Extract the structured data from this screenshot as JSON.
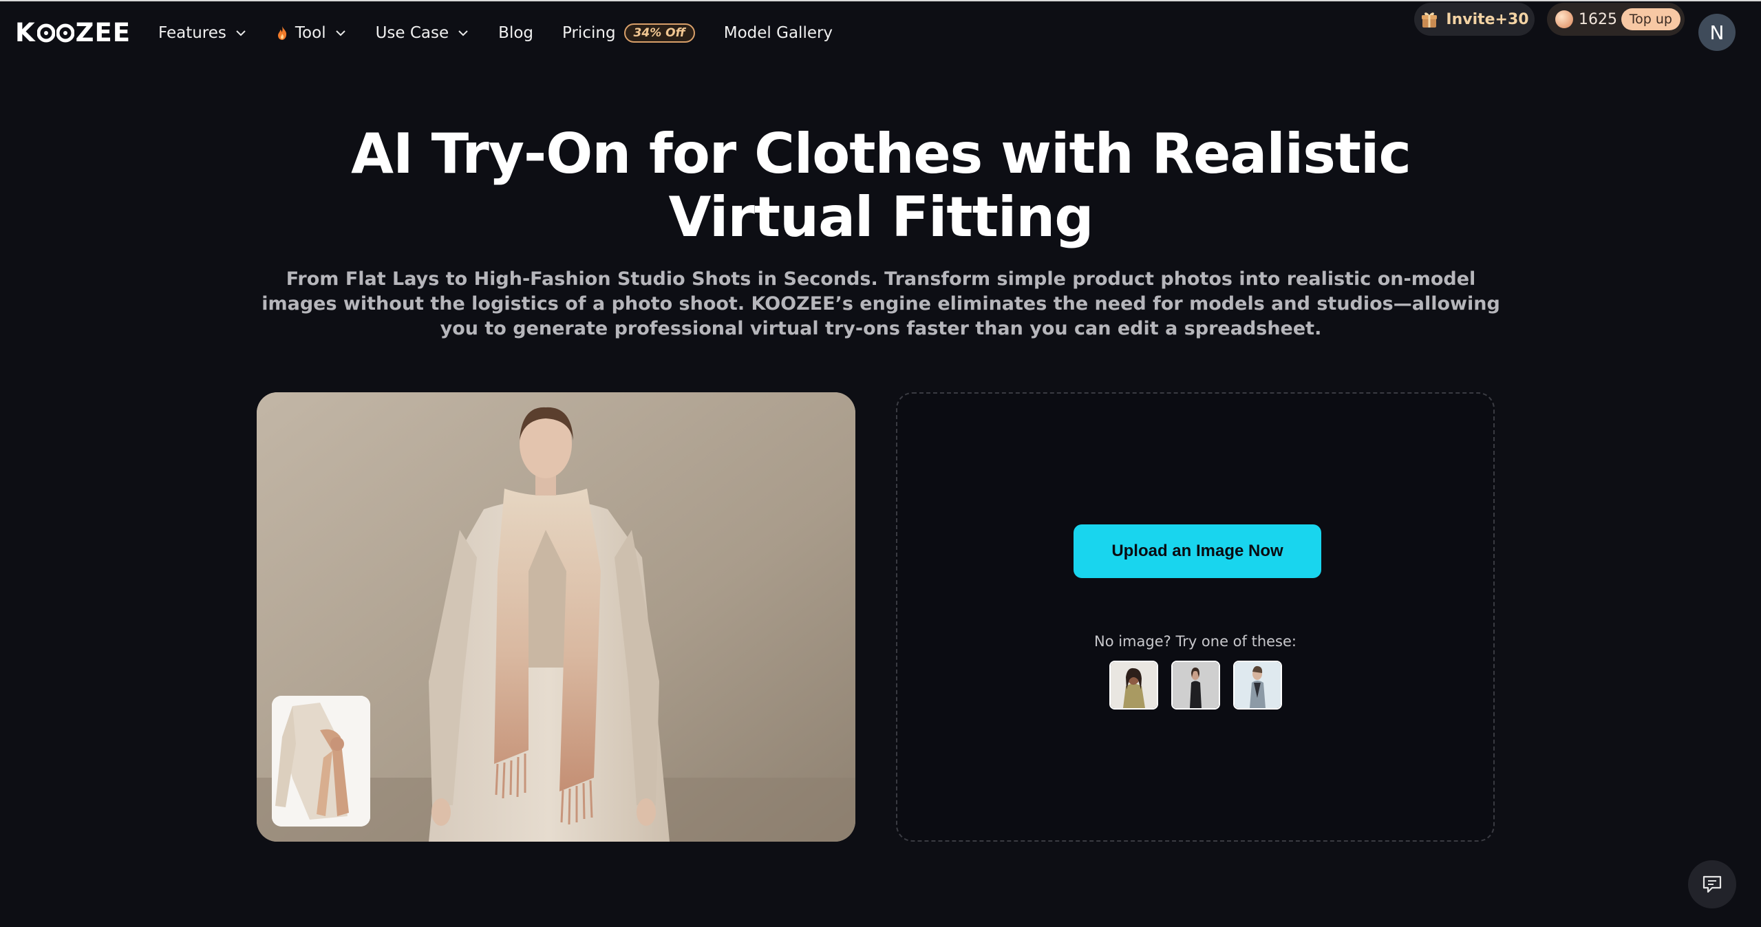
{
  "brand": {
    "logo_text": "KOOZEE"
  },
  "nav": {
    "items": [
      {
        "label": "Features",
        "has_dropdown": true
      },
      {
        "label": "Tool",
        "has_dropdown": true,
        "icon": "flame-icon"
      },
      {
        "label": "Use Case",
        "has_dropdown": true
      },
      {
        "label": "Blog",
        "has_dropdown": false
      },
      {
        "label": "Pricing",
        "has_dropdown": false,
        "badge": "34% Off"
      },
      {
        "label": "Model Gallery",
        "has_dropdown": false
      }
    ]
  },
  "header_actions": {
    "invite_label": "Invite+30",
    "credits": "1625",
    "topup_label": "Top up",
    "avatar_initial": "N"
  },
  "hero": {
    "title_line1": "AI Try-On for Clothes with Realistic",
    "title_line2": "Virtual Fitting",
    "subtitle": "From Flat Lays to High-Fashion Studio Shots in Seconds. Transform simple product photos into realistic on-model images without the logistics of a photo shoot. KOOZEE’s engine eliminates the need for models and studios—allowing you to generate professional virtual try-ons faster than you can edit a spreadsheet."
  },
  "upload": {
    "button_label": "Upload an Image Now",
    "samples_label": "No image? Try one of these:",
    "sample_count": 3
  },
  "colors": {
    "background": "#0d0e14",
    "accent": "#19d5ee",
    "badge_border": "#d9a06a",
    "topup_bg": "#f7c8a4"
  }
}
